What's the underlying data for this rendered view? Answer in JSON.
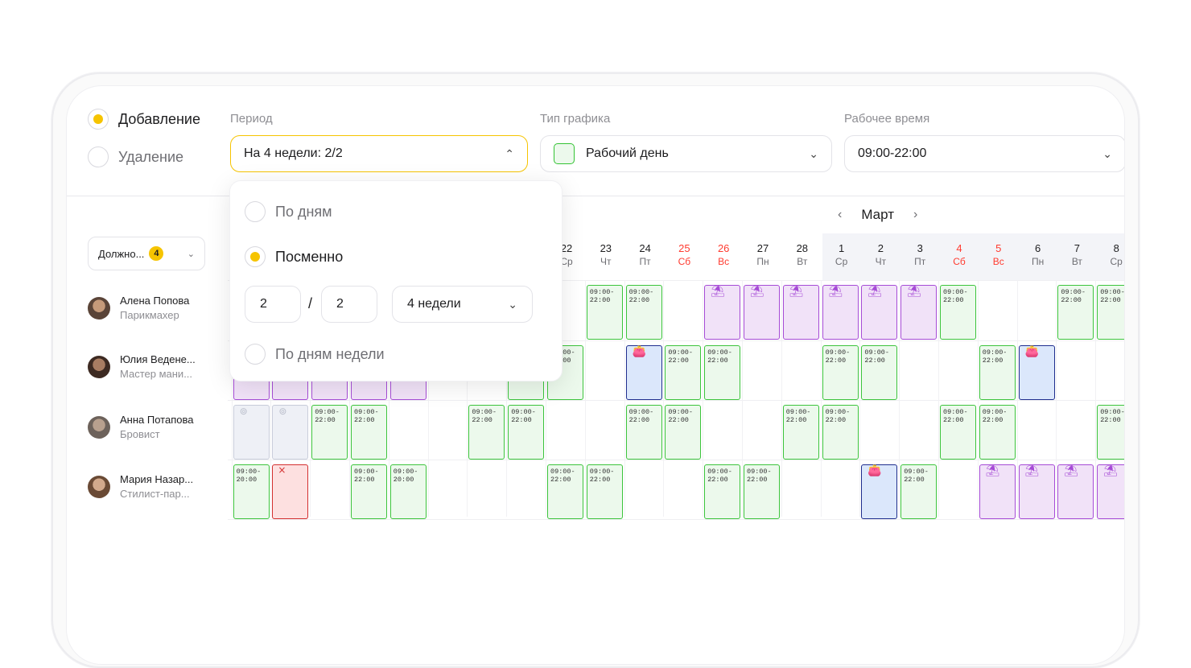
{
  "mode": {
    "add_label": "Добавление",
    "remove_label": "Удаление",
    "selected": "add"
  },
  "period": {
    "label": "Период",
    "value": "На 4 недели: 2/2",
    "options": {
      "by_days": "По дням",
      "by_shift": "Посменно",
      "by_weekdays": "По дням недели"
    },
    "selected_option": "by_shift",
    "shift_on": "2",
    "separator": "/",
    "shift_off": "2",
    "duration": "4 недели"
  },
  "schedule_type": {
    "label": "Тип графика",
    "value": "Рабочий день",
    "swatch_color": "#34c334"
  },
  "work_time": {
    "label": "Рабочее время",
    "value": "09:00-22:00"
  },
  "calendar": {
    "month": "Март",
    "prev_icon": "chevron-left-icon",
    "next_icon": "chevron-right-icon",
    "filter_label": "Должно...",
    "filter_count": "4",
    "days": [
      {
        "d": "22",
        "w": "Ср",
        "red": false
      },
      {
        "d": "23",
        "w": "Чт",
        "red": false
      },
      {
        "d": "24",
        "w": "Пт",
        "red": false
      },
      {
        "d": "25",
        "w": "Сб",
        "red": true
      },
      {
        "d": "26",
        "w": "Вс",
        "red": true
      },
      {
        "d": "27",
        "w": "Пн",
        "red": false
      },
      {
        "d": "28",
        "w": "Вт",
        "red": false
      },
      {
        "d": "1",
        "w": "Ср",
        "red": false
      },
      {
        "d": "2",
        "w": "Чт",
        "red": false
      },
      {
        "d": "3",
        "w": "Пт",
        "red": false
      },
      {
        "d": "4",
        "w": "Сб",
        "red": true
      },
      {
        "d": "5",
        "w": "Вс",
        "red": true
      },
      {
        "d": "6",
        "w": "Пн",
        "red": false
      },
      {
        "d": "7",
        "w": "Вт",
        "red": false
      },
      {
        "d": "8",
        "w": "Ср",
        "red": false
      }
    ]
  },
  "employees": [
    {
      "name": "Алена Попова",
      "role": "Парикмахер"
    },
    {
      "name": "Юлия Ведене...",
      "role": "Мастер мани..."
    },
    {
      "name": "Анна Потапова",
      "role": "Бровист"
    },
    {
      "name": "Мария Назар...",
      "role": "Стилист-пар..."
    }
  ],
  "shift_text": {
    "a": "09:00-\n22:00",
    "b": "09:00-\n20:00"
  },
  "status_icons": {
    "vacation": "umbrella-icon",
    "sick": "wallet-icon",
    "absent": "close-icon",
    "dayoff": "dayoff-icon"
  },
  "colors": {
    "accent": "#f6c400",
    "work": "#34c334",
    "vacation": "#a64bd6",
    "sick": "#1f2e8e",
    "absent": "#d32f2f",
    "weekend": "#ff3b30"
  }
}
